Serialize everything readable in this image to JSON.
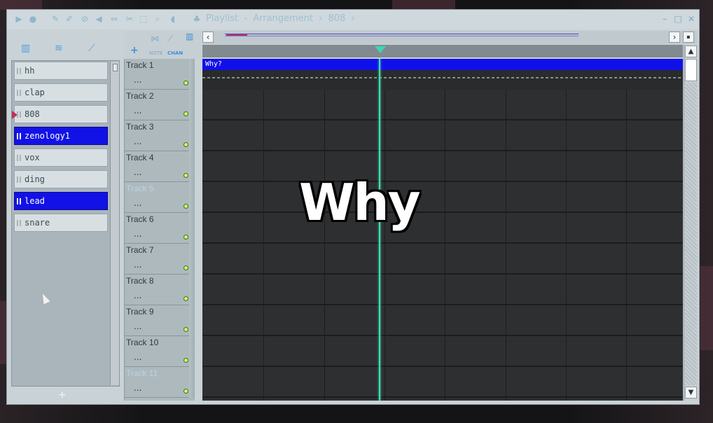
{
  "window": {
    "title_app": "Playlist",
    "title_sep": "-",
    "title_section": "Arrangement",
    "title_pattern": "808",
    "title_arrow": "›"
  },
  "left_tabs": {
    "icon_1": "piano-icon",
    "icon_2": "audio-wave-icon",
    "icon_3": "automation-icon"
  },
  "channels": [
    {
      "label": "hh",
      "selected": false
    },
    {
      "label": "clap",
      "selected": false
    },
    {
      "label": "808",
      "selected": false,
      "active_marker": true
    },
    {
      "label": "zenology1",
      "selected": true
    },
    {
      "label": "vox",
      "selected": false
    },
    {
      "label": "ding",
      "selected": false
    },
    {
      "label": "lead",
      "selected": true
    },
    {
      "label": "snare",
      "selected": false
    }
  ],
  "top_controls": {
    "plus": "+",
    "label_note": "NOTE",
    "label_chan": "CHAN"
  },
  "nav": {
    "left": "‹",
    "right": "›",
    "menu": "▪"
  },
  "tracks": [
    {
      "name": "Track 1",
      "dots": "...",
      "dim": false
    },
    {
      "name": "Track 2",
      "dots": "...",
      "dim": false
    },
    {
      "name": "Track 3",
      "dots": "...",
      "dim": false
    },
    {
      "name": "Track 4",
      "dots": "...",
      "dim": false
    },
    {
      "name": "Track 5",
      "dots": "...",
      "dim": true
    },
    {
      "name": "Track 6",
      "dots": "...",
      "dim": false
    },
    {
      "name": "Track 7",
      "dots": "...",
      "dim": false
    },
    {
      "name": "Track 8",
      "dots": "...",
      "dim": false
    },
    {
      "name": "Track 9",
      "dots": "...",
      "dim": false
    },
    {
      "name": "Track 10",
      "dots": "...",
      "dim": false
    },
    {
      "name": "Track 11",
      "dots": "...",
      "dim": true
    }
  ],
  "clip": {
    "label": "Why?"
  },
  "overlay_text": "Why",
  "add_channel": "+",
  "scroll": {
    "up": "^",
    "down": "v"
  },
  "colors": {
    "selected_channel": "#1212e6",
    "clip": "#1010ea",
    "playhead": "#40e0b4",
    "led": "#d7f06a"
  }
}
